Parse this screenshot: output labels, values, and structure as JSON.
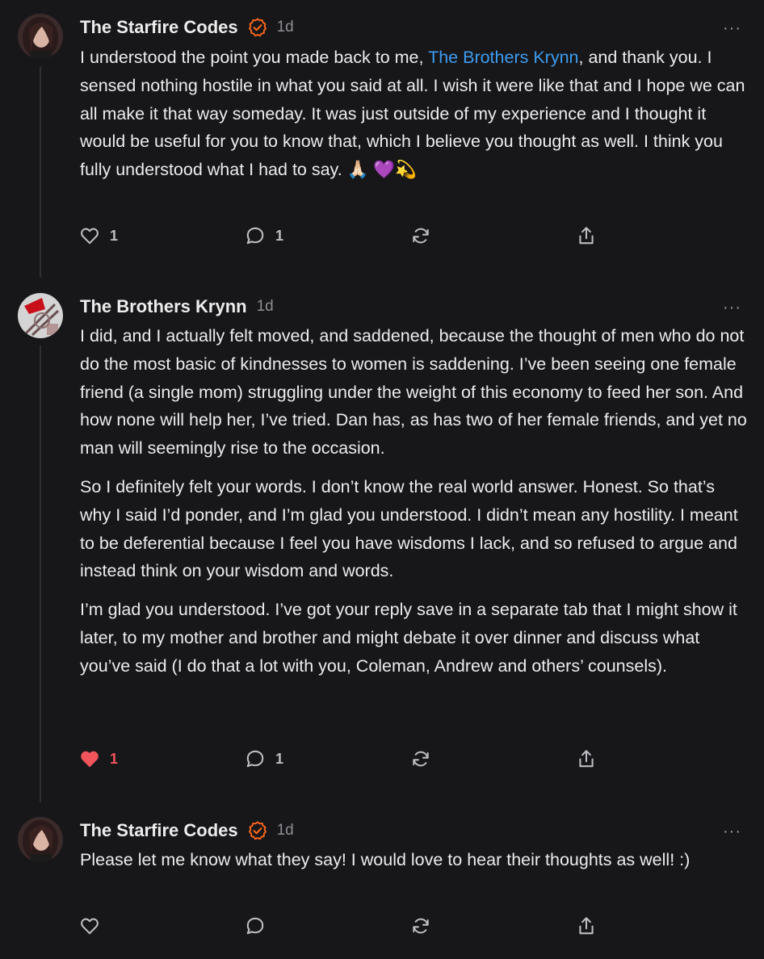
{
  "comments": [
    {
      "author": "The Starfire Codes",
      "verified": true,
      "time": "1d",
      "more": "···",
      "body_pre": "I understood the point you made back to me, ",
      "mention": "The Brothers Krynn",
      "body_post": ", and thank you. I sensed nothing hostile in what you said at all. I wish it were like that and I hope we can all make it that way someday. It was just outside of my experience and I thought it would be useful for you to know that, which I believe you thought as well. I think you fully understood what I had to say. 🙏🏻 💜💫",
      "likes": "1",
      "replies": "1",
      "liked": false
    },
    {
      "author": "The Brothers Krynn",
      "verified": false,
      "time": "1d",
      "more": "···",
      "paragraphs": [
        "I did, and I actually felt moved, and saddened, because the thought of men who do not do the most basic of kindnesses to women is saddening. I’ve been seeing one female friend (a single mom) struggling under the weight of this economy to feed her son. And how none will help her, I’ve tried. Dan has, as has two of her female friends, and yet no man will seemingly rise to the occasion.",
        "So I definitely felt your words. I don’t know the real world answer. Honest. So that’s why I said I’d ponder, and I’m glad you understood. I didn’t mean any hostility. I meant to be deferential because I feel you have wisdoms I lack, and so refused to argue and instead think on your wisdom and words.",
        "I’m glad you understood. I’ve got your reply save in a separate tab that I might show it later, to my mother and brother and might debate it over dinner and discuss what you’ve said (I do that a lot with you, Coleman, Andrew and others’ counsels)."
      ],
      "likes": "1",
      "replies": "1",
      "liked": true
    },
    {
      "author": "The Starfire Codes",
      "verified": true,
      "time": "1d",
      "more": "···",
      "body": "Please let me know what they say! I would love to hear their thoughts as well! :)",
      "liked": false
    }
  ],
  "icons": {
    "like": "heart-icon",
    "liked": "heart-filled-icon",
    "reply": "comment-bubble-icon",
    "restack": "restack-icon",
    "share": "share-icon",
    "verified": "verified-check-icon",
    "more": "more-dots-icon"
  },
  "colors": {
    "background": "#17171a",
    "text": "#ececec",
    "muted": "#8e8e93",
    "mention": "#3d9cf0",
    "verified": "#ff6719",
    "liked": "#f2545b"
  }
}
